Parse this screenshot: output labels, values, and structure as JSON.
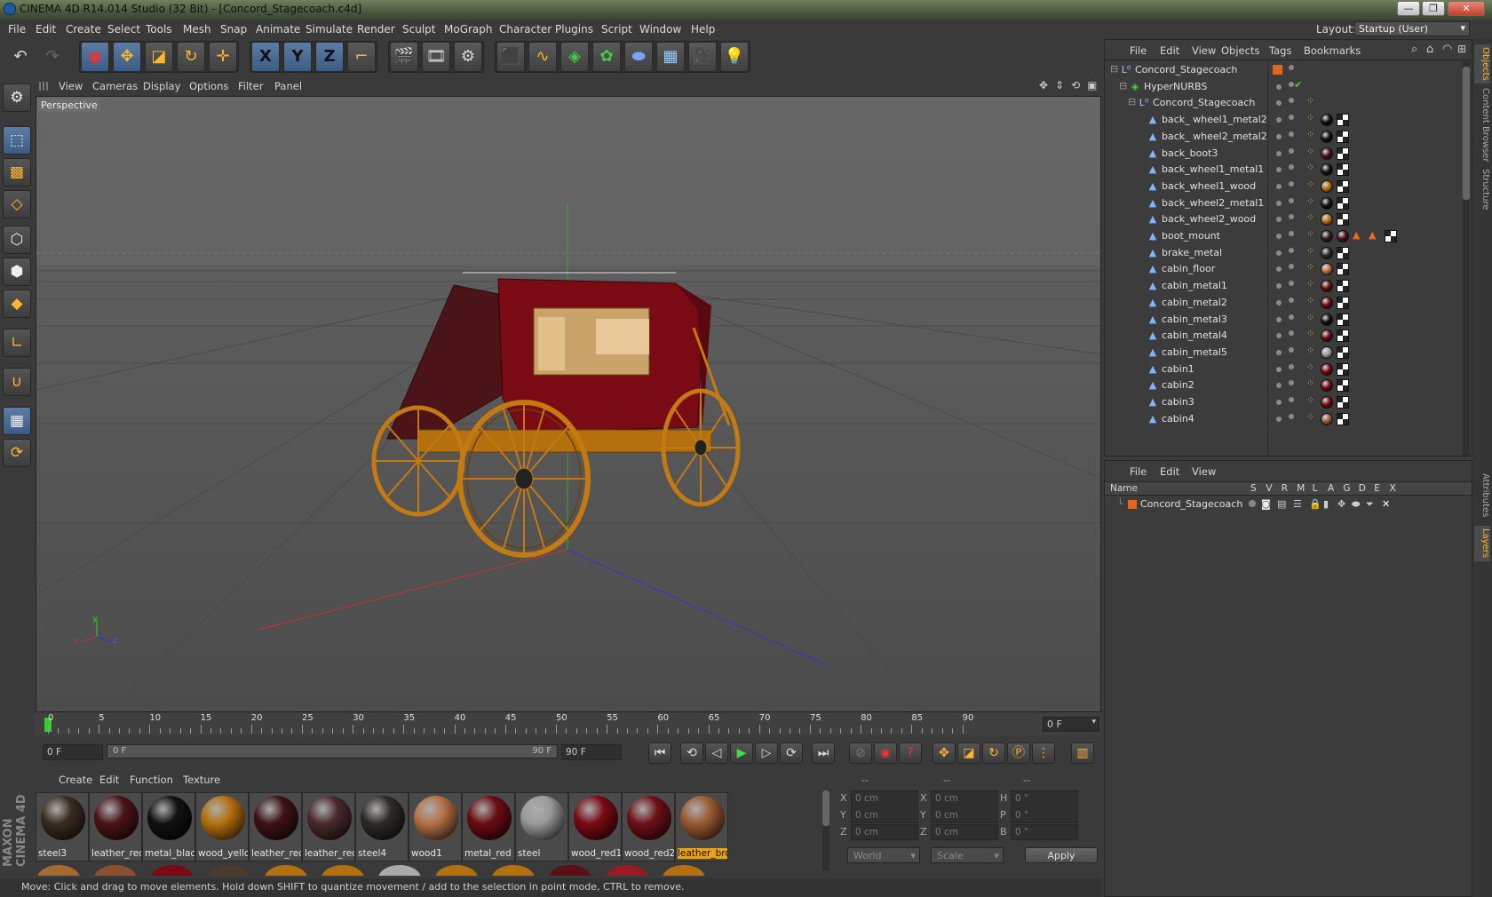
{
  "window": {
    "title": "CINEMA 4D R14.014 Studio (32 Bit) - [Concord_Stagecoach.c4d]",
    "minimize": "—",
    "restore": "❐",
    "close": "✕"
  },
  "menu": [
    "File",
    "Edit",
    "Create",
    "Select",
    "Tools",
    "Mesh",
    "Snap",
    "Animate",
    "Simulate",
    "Render",
    "Sculpt",
    "MoGraph",
    "Character",
    "Plugins",
    "Script",
    "Window",
    "Help"
  ],
  "layout": {
    "label": "Layout:",
    "value": "Startup (User)"
  },
  "toolbar": {
    "x": "X",
    "y": "Y",
    "z": "Z"
  },
  "viewport": {
    "menu": [
      "View",
      "Cameras",
      "Display",
      "Options",
      "Filter",
      "Panel"
    ],
    "label": "Perspective",
    "axis_x": "x",
    "axis_y": "y",
    "axis_z": "z"
  },
  "timeline": {
    "ticks": [
      "0",
      "5",
      "10",
      "15",
      "20",
      "25",
      "30",
      "35",
      "40",
      "45",
      "50",
      "55",
      "60",
      "65",
      "70",
      "75",
      "80",
      "85",
      "90"
    ],
    "frame_field": "0 F"
  },
  "transport": {
    "start": "0 F",
    "slider_left": "0 F",
    "slider_right": "90 F",
    "end": "90 F"
  },
  "materials": {
    "menu": [
      "Create",
      "Edit",
      "Function",
      "Texture"
    ],
    "items": [
      {
        "name": "steel3",
        "color": "#3a2c22"
      },
      {
        "name": "leather_red",
        "color": "#4a1418"
      },
      {
        "name": "metal_black",
        "color": "#111111"
      },
      {
        "name": "wood_yellow",
        "color": "#b4700e"
      },
      {
        "name": "leather_red",
        "color": "#3c1216"
      },
      {
        "name": "leather_red",
        "color": "#4a2a2c"
      },
      {
        "name": "steel4",
        "color": "#2e2a26"
      },
      {
        "name": "wood1",
        "color": "#b57046"
      },
      {
        "name": "metal_red",
        "color": "#6a0c12"
      },
      {
        "name": "steel",
        "color": "#9a9a9a"
      },
      {
        "name": "wood_red1",
        "color": "#7a0a14"
      },
      {
        "name": "wood_red2",
        "color": "#6e1018"
      },
      {
        "name": "leather_bro",
        "color": "#9a5a34"
      }
    ]
  },
  "coords": {
    "headers": [
      "--",
      "--",
      "--"
    ],
    "rows": [
      {
        "a": "X",
        "av": "0 cm",
        "b": "X",
        "bv": "0 cm",
        "c": "H",
        "cv": "0 °"
      },
      {
        "a": "Y",
        "av": "0 cm",
        "b": "Y",
        "bv": "0 cm",
        "c": "P",
        "cv": "0 °"
      },
      {
        "a": "Z",
        "av": "0 cm",
        "b": "Z",
        "bv": "0 cm",
        "c": "B",
        "cv": "0 °"
      }
    ],
    "world": "World",
    "scale": "Scale",
    "apply": "Apply"
  },
  "status": "Move: Click and drag to move elements. Hold down SHIFT to quantize movement / add to the selection in point mode, CTRL to remove.",
  "objects": {
    "menu": [
      "File",
      "Edit",
      "View",
      "Objects",
      "Tags",
      "Bookmarks"
    ],
    "rows": [
      {
        "name": "Concord_Stagecoach",
        "indent": 0,
        "type": "null"
      },
      {
        "name": "HyperNURBS",
        "indent": 1,
        "type": "nurbs"
      },
      {
        "name": "Concord_Stagecoach",
        "indent": 2,
        "type": "null"
      },
      {
        "name": "back_ wheel1_metal2",
        "indent": 3,
        "type": "poly",
        "mat": "#111"
      },
      {
        "name": "back_ wheel2_metal2",
        "indent": 3,
        "type": "poly",
        "mat": "#111"
      },
      {
        "name": "back_boot3",
        "indent": 3,
        "type": "poly",
        "mat": "#4a1418"
      },
      {
        "name": "back_wheel1_metal1",
        "indent": 3,
        "type": "poly",
        "mat": "#111"
      },
      {
        "name": "back_wheel1_wood",
        "indent": 3,
        "type": "poly",
        "mat": "#b4700e"
      },
      {
        "name": "back_wheel2_metal1",
        "indent": 3,
        "type": "poly",
        "mat": "#111"
      },
      {
        "name": "back_wheel2_wood",
        "indent": 3,
        "type": "poly",
        "mat": "#b4700e"
      },
      {
        "name": "boot_mount",
        "indent": 3,
        "type": "poly",
        "mat": "#3a1a1a"
      },
      {
        "name": "brake_metal",
        "indent": 3,
        "type": "poly",
        "mat": "#2e2a26"
      },
      {
        "name": "cabin_floor",
        "indent": 3,
        "type": "poly",
        "mat": "#b57046"
      },
      {
        "name": "cabin_metal1",
        "indent": 3,
        "type": "poly",
        "mat": "#6a0c12"
      },
      {
        "name": "cabin_metal2",
        "indent": 3,
        "type": "poly",
        "mat": "#6a0c12"
      },
      {
        "name": "cabin_metal3",
        "indent": 3,
        "type": "poly",
        "mat": "#111"
      },
      {
        "name": "cabin_metal4",
        "indent": 3,
        "type": "poly",
        "mat": "#6a0c12"
      },
      {
        "name": "cabin_metal5",
        "indent": 3,
        "type": "poly",
        "mat": "#9a9a9a"
      },
      {
        "name": "cabin1",
        "indent": 3,
        "type": "poly",
        "mat": "#7a0a14"
      },
      {
        "name": "cabin2",
        "indent": 3,
        "type": "poly",
        "mat": "#7a0a14"
      },
      {
        "name": "cabin3",
        "indent": 3,
        "type": "poly",
        "mat": "#7a0a14"
      },
      {
        "name": "cabin4",
        "indent": 3,
        "type": "poly",
        "mat": "#9a5a34"
      }
    ]
  },
  "layers": {
    "menu": [
      "File",
      "Edit",
      "View"
    ],
    "name_header": "Name",
    "cols": [
      "S",
      "V",
      "R",
      "M",
      "L",
      "A",
      "G",
      "D",
      "E",
      "X"
    ],
    "row": "Concord_Stagecoach"
  },
  "side_tabs": {
    "top": [
      "Objects",
      "Content Browser",
      "Structure"
    ],
    "bottom": [
      "Attributes",
      "Layers"
    ]
  },
  "brand": "MAXON CINEMA 4D"
}
